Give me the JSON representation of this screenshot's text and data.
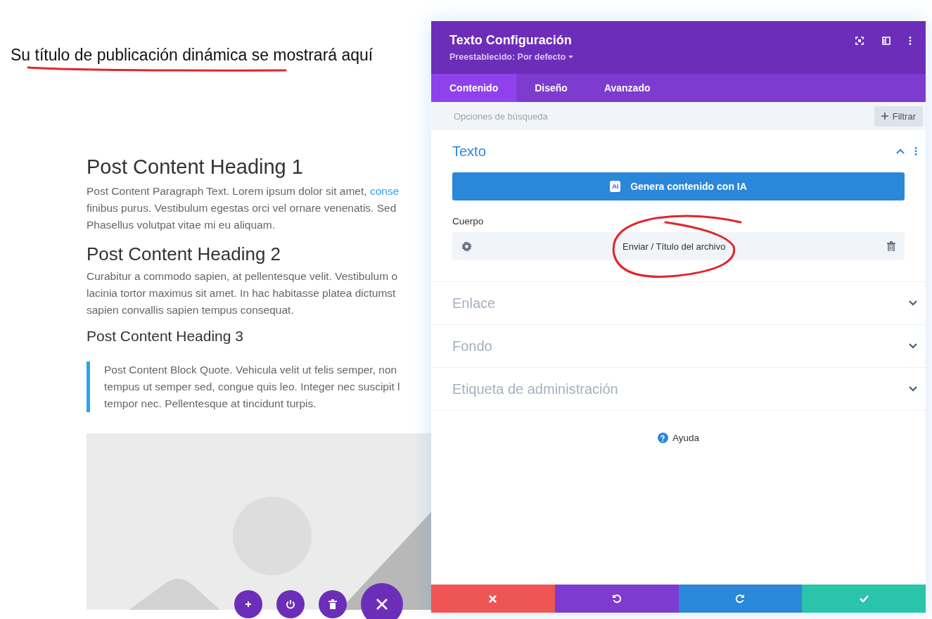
{
  "page": {
    "title": "Su título de publicación dinámica se mostrará aquí",
    "blocks": [
      {
        "kind": "h1",
        "text": "Post Content Heading 1"
      },
      {
        "kind": "paragraph",
        "lines": [
          "Post Content Paragraph Text. Lorem ipsum dolor sit amet,",
          "finibus purus. Vestibulum egestas orci vel ornare venenatis. Sed",
          "Phasellus volutpat vitae mi eu aliquam."
        ],
        "link": "conse"
      },
      {
        "kind": "h2",
        "text": "Post Content Heading 2"
      },
      {
        "kind": "paragraph",
        "lines": [
          "Curabitur a commodo sapien, at pellentesque velit. Vestibulum o",
          "lacinia tortor maximus sit amet. In hac habitasse platea dictumst",
          "sapien convallis sapien tempus consequat."
        ]
      },
      {
        "kind": "h3",
        "text": "Post Content Heading 3"
      },
      {
        "kind": "quote",
        "lines": [
          "Post Content Block Quote. Vehicula velit ut felis semper, non",
          "tempus ut semper sed, congue quis leo. Integer nec suscipit l",
          "tempor nec. Pellentesque at tincidunt turpis."
        ]
      }
    ],
    "floating_buttons": [
      {
        "kind": "add"
      },
      {
        "kind": "power"
      },
      {
        "kind": "delete"
      },
      {
        "kind": "close"
      }
    ]
  },
  "panel": {
    "title": "Texto Configuración",
    "preset": "Preestablecido: Por defecto",
    "tabs": [
      {
        "label": "Contenido",
        "selected": true
      },
      {
        "label": "Diseño",
        "selected": false
      },
      {
        "label": "Avanzado",
        "selected": false
      }
    ],
    "search": {
      "placeholder": "Opciones de búsqueda"
    },
    "filter_button": "Filtrar",
    "sections": [
      {
        "title": "Texto",
        "expanded": true,
        "ai_button": "Genera contenido con IA",
        "ai_badge": "AI",
        "field_label": "Cuerpo",
        "field_value": "Enviar / Título del archivo"
      },
      {
        "title": "Enlace",
        "expanded": false
      },
      {
        "title": "Fondo",
        "expanded": false
      },
      {
        "title": "Etiqueta de administración",
        "expanded": false
      }
    ],
    "help": "Ayuda",
    "footer_buttons": [
      {
        "kind": "cancel"
      },
      {
        "kind": "undo"
      },
      {
        "kind": "redo"
      },
      {
        "kind": "save"
      }
    ]
  }
}
